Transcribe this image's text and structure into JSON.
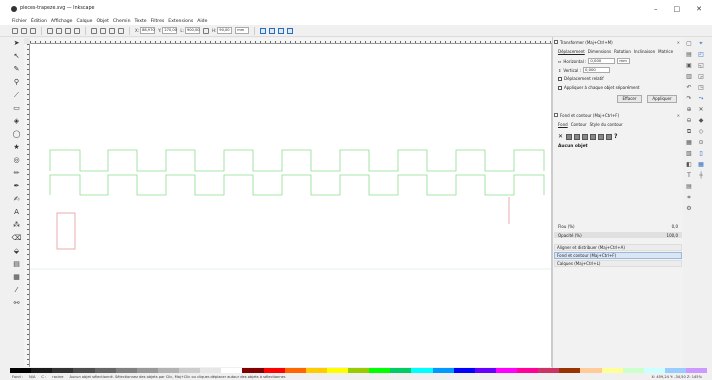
{
  "window": {
    "title": "pieces-trapeze.svg — Inkscape",
    "controls": [
      "–",
      "□",
      "✕"
    ]
  },
  "menu": [
    "Fichier",
    "Édition",
    "Affichage",
    "Calque",
    "Objet",
    "Chemin",
    "Texte",
    "Filtres",
    "Extensions",
    "Aide"
  ],
  "commandbar": {
    "x_label": "X:",
    "x_value": "88,970",
    "y_label": "Y:",
    "y_value": "270,00",
    "w_label": "L:",
    "w_value": "900,00",
    "h_label": "H:",
    "h_value": "90,00",
    "unit": "mm"
  },
  "transform_panel": {
    "title": "Transformer (Maj+Ctrl+M)",
    "tabs": [
      "Déplacement",
      "Dimensions",
      "Rotation",
      "Inclinaison",
      "Matrice"
    ],
    "horizontal_label": "Horizontal :",
    "horizontal_value": "0,000",
    "vertical_label": "Vertical :",
    "vertical_value": "0,000",
    "unit": "mm",
    "relative_label": "Déplacement relatif",
    "apply_each_label": "Appliquer à chaque objet séparément",
    "clear_button": "Effacer",
    "apply_button": "Appliquer"
  },
  "fill_stroke_panel": {
    "title": "Fond et contour (Maj+Ctrl+F)",
    "tabs": [
      "Fond",
      "Contour",
      "Style du contour"
    ],
    "no_object": "Aucun objet",
    "flou_label": "Flou (%)",
    "flou_value": "0,0",
    "opacity_label": "Opacité (%)",
    "opacity_value": "100,0"
  },
  "collapsed_panels": [
    {
      "label": "Aligner et distribuer (Maj+Ctrl+A)",
      "selected": false
    },
    {
      "label": "Fond et contour (Maj+Ctrl+F)",
      "selected": true
    },
    {
      "label": "Calques (Maj+Ctrl+L)",
      "selected": false
    }
  ],
  "status": {
    "fill_label": "Fond :",
    "fill_value": "N/A",
    "stroke_label": "C :",
    "layer": "racine",
    "message": "Aucun objet sélectionné. Sélectionnez des objets par Clic, Maj+Clic ou cliquer-déplacer autour des objets à sélectionner.",
    "x": "X: 459,24",
    "y": "Y: -34,50",
    "zoom": "Z: 145%"
  },
  "colors": {
    "accent": "#2d6bbf",
    "path_green": "#8fdc8f",
    "path_pink": "#e79a9a",
    "canvas": "#ffffff"
  },
  "palette": [
    "#000000",
    "#1a1a1a",
    "#333333",
    "#4d4d4d",
    "#666666",
    "#808080",
    "#999999",
    "#b3b3b3",
    "#cccccc",
    "#e6e6e6",
    "#ffffff",
    "#800000",
    "#ff0000",
    "#ff6600",
    "#ffcc00",
    "#ffff00",
    "#99cc00",
    "#00ff00",
    "#00cc66",
    "#00ffff",
    "#0099ff",
    "#0000ff",
    "#6600ff",
    "#ff00ff",
    "#ff0099",
    "#cc3366",
    "#993300",
    "#ffcc99",
    "#ffff99",
    "#ccffcc",
    "#ccffff",
    "#99ccff",
    "#cc99ff"
  ]
}
